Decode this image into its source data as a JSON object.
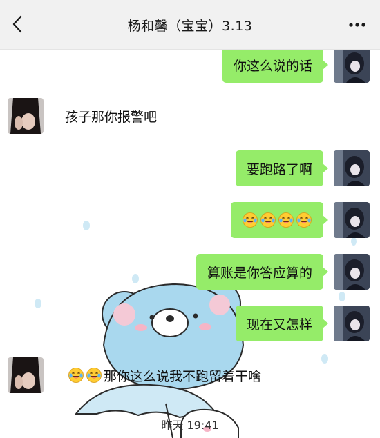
{
  "header": {
    "title": "杨和馨（宝宝）3.13",
    "back_icon": "chevron-left-icon",
    "more_icon": "more-dots-icon"
  },
  "messages": [
    {
      "from": "me",
      "text": "你这么说的话"
    },
    {
      "from": "other",
      "text": "孩子那你报警吧"
    },
    {
      "from": "me",
      "text": "要跑路了啊"
    },
    {
      "from": "me",
      "emoji": "laugh-cry-emoji",
      "emoji_count": 4
    },
    {
      "from": "me",
      "text": "算账是你答应算的"
    },
    {
      "from": "me",
      "text": "现在又怎样"
    },
    {
      "from": "other",
      "emoji": "laugh-cry-emoji",
      "emoji_count": 2,
      "text": "那你这么说我不跑留着干啥"
    }
  ],
  "timestamp": "昨天 19:41",
  "colors": {
    "header_bg": "#f1f1f1",
    "my_bubble": "#95ec69",
    "wallpaper_bear": "#a9d8ee"
  }
}
